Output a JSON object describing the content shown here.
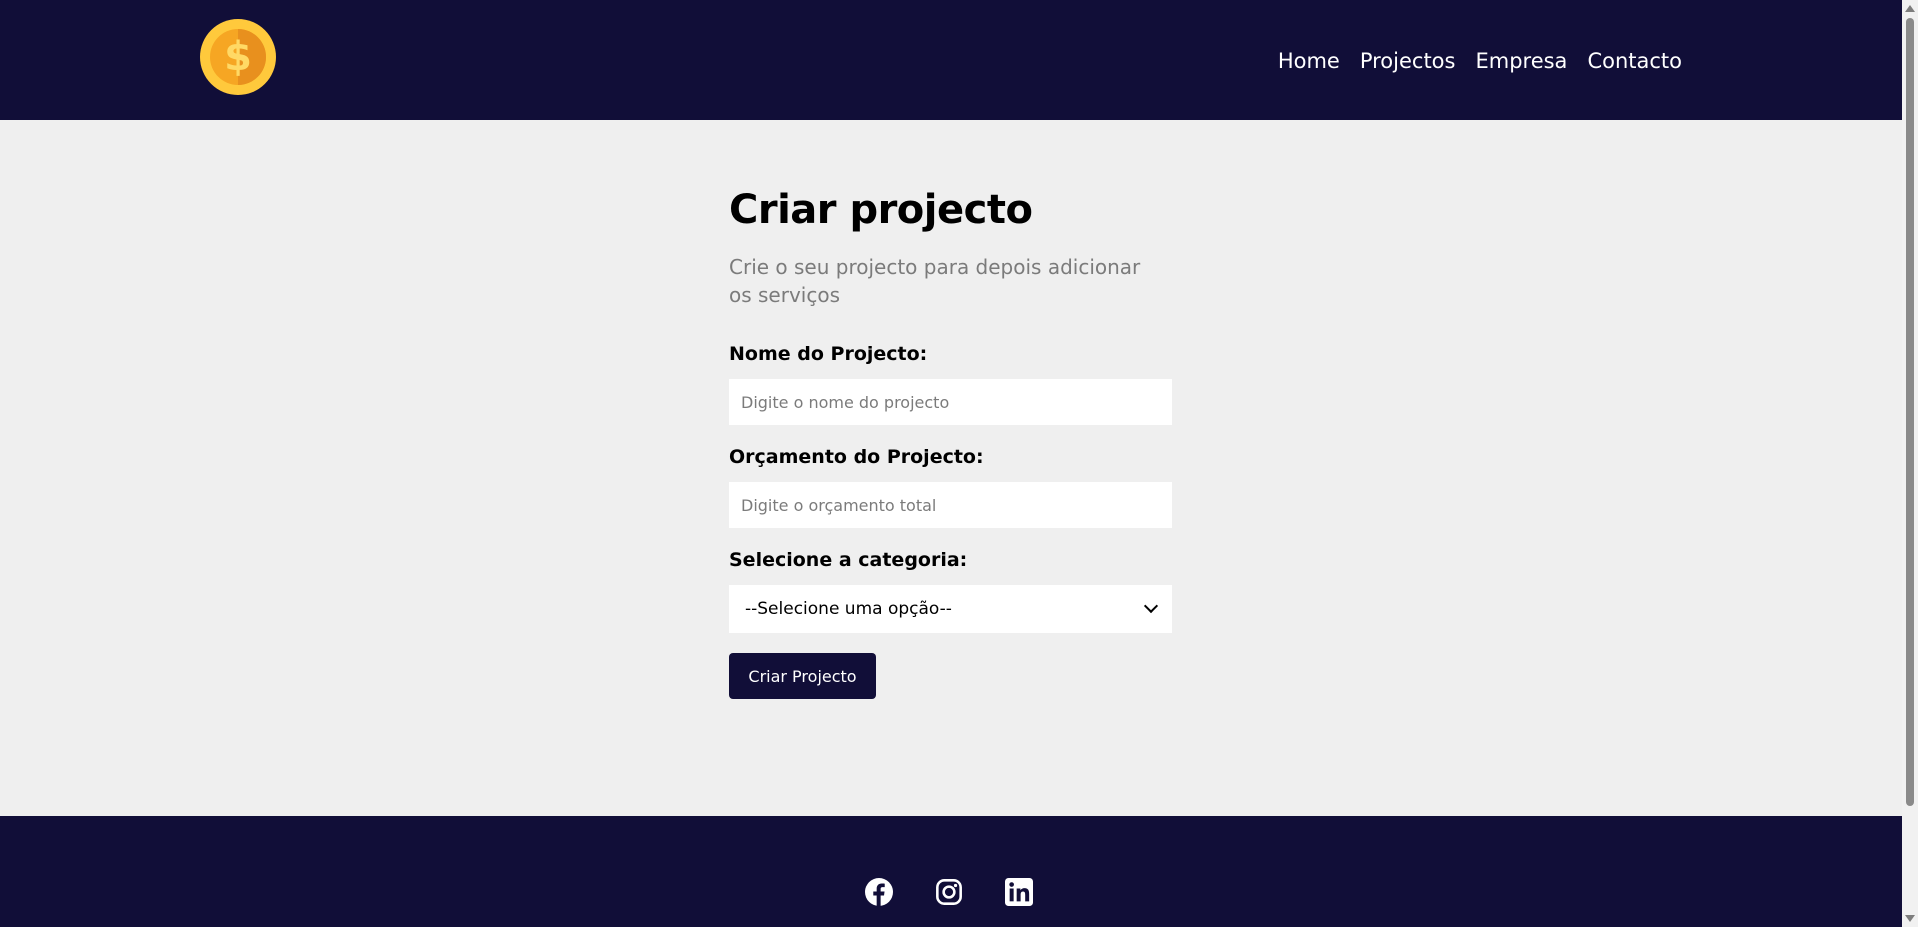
{
  "nav": {
    "logo_icon": "dollar-coin-icon",
    "logo_glyph": "$",
    "links": [
      "Home",
      "Projectos",
      "Empresa",
      "Contacto"
    ]
  },
  "main": {
    "title": "Criar projecto",
    "subtitle": "Crie o seu projecto para depois adicionar os serviços",
    "name_label": "Nome do Projecto:",
    "name_placeholder": "Digite o nome do projecto",
    "budget_label": "Orçamento do Projecto:",
    "budget_placeholder": "Digite o orçamento total",
    "category_label": "Selecione a categoria:",
    "category_selected": "--Selecione uma opção--",
    "submit_label": "Criar Projecto"
  },
  "footer": {
    "social_icons": [
      "facebook-icon",
      "instagram-icon",
      "linkedin-icon"
    ]
  },
  "colors": {
    "primary_dark": "#110e38",
    "background": "#efefef",
    "coin_yellow": "#ffc93c"
  }
}
